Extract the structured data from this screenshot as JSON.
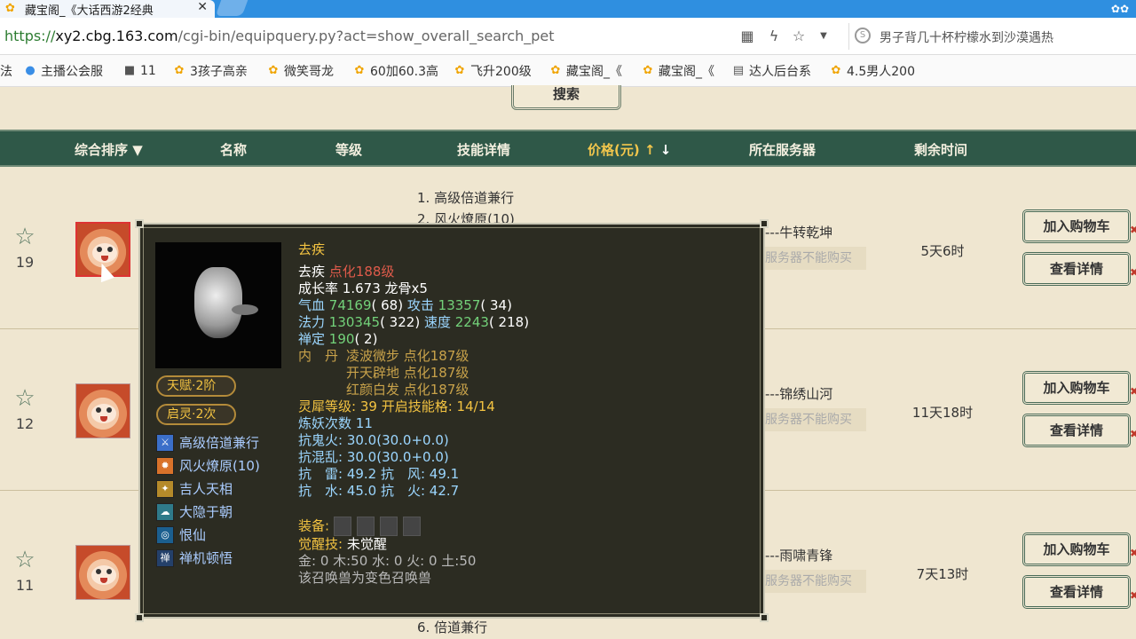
{
  "browser": {
    "tab_title": "藏宝阁_《大话西游2经典",
    "url_scheme": "https://",
    "url_host": "xy2.cbg.163.com",
    "url_path": "/cgi-bin/equipquery.py?act=show_overall_search_pet",
    "search_text": "男子背几十杯柠檬水到沙漠遇热",
    "bookmarks": [
      "法",
      "主播公会服",
      "11",
      "3孩子高亲",
      "微笑哥龙",
      "60加60.3高",
      "飞升200级",
      "藏宝阁_《",
      "藏宝阁_《",
      "达人后台系",
      "4.5男人200"
    ]
  },
  "page": {
    "search_button": "搜索",
    "columns": [
      "综合排序",
      "名称",
      "等级",
      "技能详情",
      "价格(元)",
      "所在服务器",
      "剩余时间"
    ],
    "listing_rows": [
      {
        "rank": "19",
        "server": "---牛转乾坤",
        "note": "服务器不能购买",
        "time": "5天6时",
        "cart": "加入购物车",
        "detail": "查看详情",
        "skills": [
          "1. 高级倍道兼行",
          "2. 风火燎原(10)"
        ]
      },
      {
        "rank": "12",
        "server": "---锦绣山河",
        "note": "服务器不能购买",
        "time": "11天18时",
        "cart": "加入购物车",
        "detail": "查看详情",
        "skills": []
      },
      {
        "rank": "11",
        "server": "---雨啸青锋",
        "note": "服务器不能购买",
        "time": "7天13时",
        "cart": "加入购物车",
        "detail": "查看详情",
        "skills": [
          "6. 倍道兼行"
        ]
      }
    ]
  },
  "tooltip": {
    "title": "去疾",
    "name": "去疾",
    "name_level": "点化188级",
    "growth_label": "成长率",
    "growth_value": "1.673 龙骨x5",
    "hp_label": "气血",
    "hp_value": "74169",
    "hp_bonus": "( 68)",
    "atk_label": "攻击",
    "atk_value": "13357",
    "atk_bonus": "( 34)",
    "mp_label": "法力",
    "mp_value": "130345",
    "mp_bonus": "( 322)",
    "spd_label": "速度",
    "spd_value": "2243",
    "spd_bonus": "( 218)",
    "zen_label": "禅定",
    "zen_value": "190",
    "zen_bonus": "( 2)",
    "inner_label": "内　丹",
    "inner": [
      "凌波微步 点化187级",
      "开天辟地 点化187级",
      "红颜白发 点化187级"
    ],
    "lingxi_label": "灵犀等级:",
    "lingxi_value": "39 开启技能格:",
    "lingxi_slots": "14/14",
    "refine_label": "炼妖次数",
    "refine_value": "11",
    "resist1": "抗鬼火: 30.0(30.0+0.0)",
    "resist2": "抗混乱: 30.0(30.0+0.0)",
    "resist3": "抗　雷: 49.2 抗　风: 49.1",
    "resist4": "抗　水: 45.0 抗　火: 42.7",
    "equip_label": "装备:",
    "awaken_label": "觉醒技:",
    "awaken_value": "未觉醒",
    "elements": "金: 0 木:50 水: 0 火: 0 土:50",
    "variant_note": "该召唤兽为变色召唤兽",
    "talent_badge": "天赋·2阶",
    "spirit_badge": "启灵·2次",
    "skills": [
      "高级倍道兼行",
      "风火燎原(10)",
      "吉人天相",
      "大隐于朝",
      "恨仙",
      "禅机顿悟"
    ],
    "skill_icons": [
      "blade-icon",
      "fire-icon",
      "luck-icon",
      "hermit-icon",
      "ring-icon",
      "zen-icon"
    ]
  }
}
